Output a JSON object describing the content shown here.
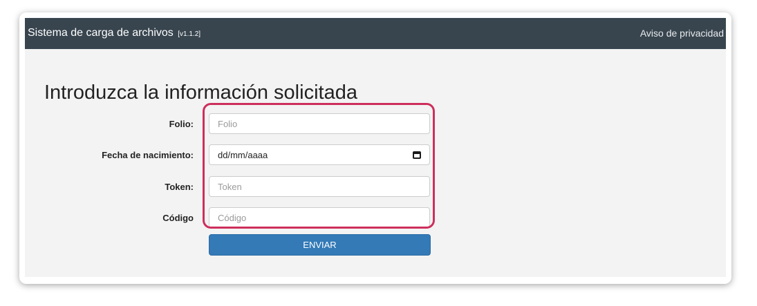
{
  "app": {
    "title": "Sistema de carga de archivos",
    "version": "[v1.1.2]",
    "privacy_link": "Aviso de privacidad"
  },
  "form": {
    "heading": "Introduzca la información solicitada",
    "fields": [
      {
        "label": "Folio:",
        "placeholder": "Folio"
      },
      {
        "label": "Fecha de nacimiento:",
        "placeholder": "dd/mm/aaaa",
        "icon": "calendar-icon"
      },
      {
        "label": "Token:",
        "placeholder": "Token"
      },
      {
        "label": "Código",
        "placeholder": "Código"
      }
    ],
    "submit_label": "ENVIAR"
  },
  "colors": {
    "navbar": "#38454f",
    "content_background": "#f3f3f3",
    "button": "#337ab7",
    "highlight_outline": "#cd2e5c"
  }
}
